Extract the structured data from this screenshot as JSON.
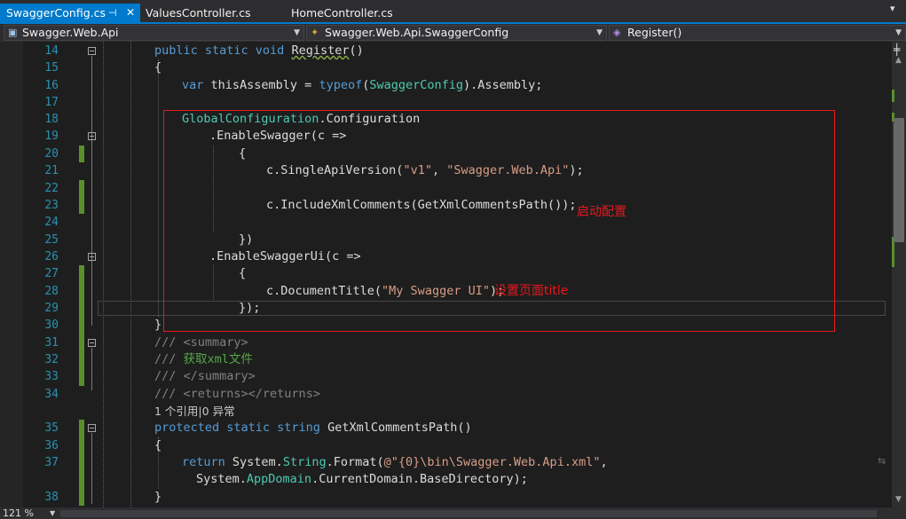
{
  "tabs": [
    {
      "label": "SwaggerConfig.cs",
      "pin": "⊣",
      "close": "✕"
    },
    {
      "label": "ValuesController.cs"
    },
    {
      "label": "HomeController.cs"
    }
  ],
  "nav": {
    "project": "Swagger.Web.Api",
    "type": "Swagger.Web.Api.SwaggerConfig",
    "member": "Register()"
  },
  "line_numbers": [
    "14",
    "15",
    "16",
    "17",
    "18",
    "19",
    "20",
    "21",
    "22",
    "23",
    "24",
    "25",
    "26",
    "27",
    "28",
    "29",
    "30",
    "31",
    "32",
    "33",
    "34",
    "35",
    "36",
    "37",
    "38"
  ],
  "code": {
    "l14_kw": "public static void",
    "l14_name": "Register",
    "l14_rest": "()",
    "l15": "{",
    "l16_kw": "var",
    "l16_a": " thisAssembly = ",
    "l16_kw2": "typeof",
    "l16_b": "(",
    "l16_type": "SwaggerConfig",
    "l16_c": ").Assembly;",
    "l18_type": "GlobalConfiguration",
    "l18_rest": ".Configuration",
    "l19": ".EnableSwagger(c =>",
    "l20": "{",
    "l21_a": "c.SingleApiVersion(",
    "l21_s1": "\"v1\"",
    "l21_b": ", ",
    "l21_s2": "\"Swagger.Web.Api\"",
    "l21_c": ");",
    "l23": "c.IncludeXmlComments(GetXmlCommentsPath());",
    "l25": "})",
    "l26": ".EnableSwaggerUi(c =>",
    "l27": "{",
    "l28_a": "c.DocumentTitle(",
    "l28_s": "\"My Swagger UI\"",
    "l28_b": ");",
    "l29": "});",
    "l30": "}",
    "l31_slash": "///",
    "l31_tag": " <summary>",
    "l32_slash": "///",
    "l32_text": " 获取xml文件",
    "l33_slash": "///",
    "l33_tag": " </summary>",
    "l34_slash": "///",
    "l34_tag": " <returns></returns>",
    "codelens": "1 个引用|0 异常",
    "l35_kw": "protected static string",
    "l35_rest": " GetXmlCommentsPath()",
    "l36": "{",
    "l37_kw": "return",
    "l37_a": " System.",
    "l37_type": "String",
    "l37_b": ".Format(",
    "l37_s": "@\"{0}\\bin\\Swagger.Web.Api.xml\"",
    "l37_c": ",",
    "l37b_a": "System.",
    "l37b_type": "AppDomain",
    "l37b_b": ".CurrentDomain.BaseDirectory);",
    "l38": "}"
  },
  "annotations": {
    "startup": "启动配置",
    "title": "设置页面title"
  },
  "status": {
    "zoom": "121 %"
  },
  "colors": {
    "accent": "#007acc",
    "annotation": "#e8181d",
    "change_marker": "#5a8f2b"
  }
}
